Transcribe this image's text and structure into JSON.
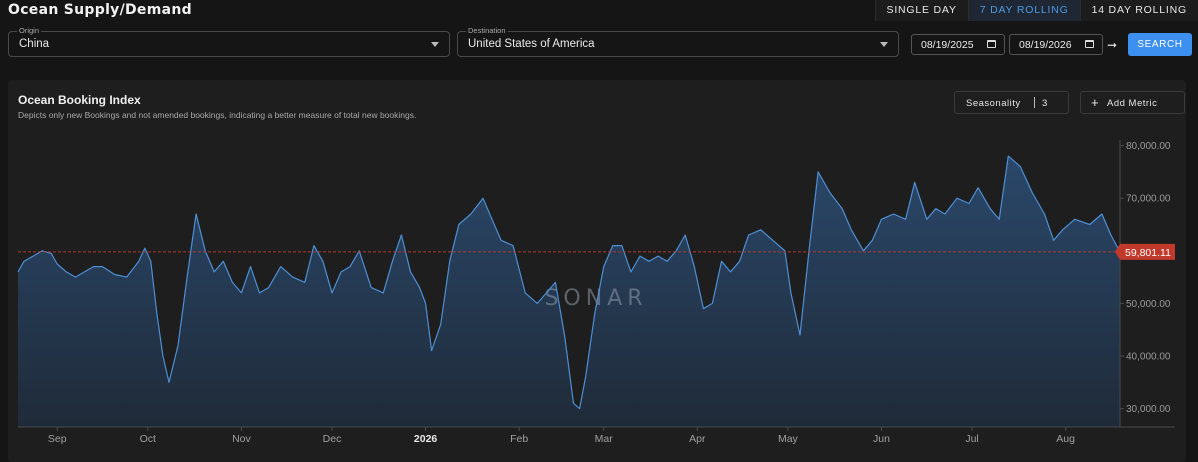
{
  "header": {
    "title": "Ocean Supply/Demand"
  },
  "timeframe": {
    "options": [
      "SINGLE DAY",
      "7 DAY ROLLING",
      "14 DAY ROLLING"
    ],
    "selected": "7 DAY ROLLING"
  },
  "filters": {
    "origin": {
      "label": "Origin",
      "value": "China"
    },
    "destination": {
      "label": "Destination",
      "value": "United States of America"
    },
    "start_date": "08/19/2025",
    "end_date": "08/19/2026",
    "arrow": "➞",
    "search_label": "SEARCH"
  },
  "panel": {
    "title": "Ocean Booking Index",
    "subtitle": "Depicts only new Bookings and not amended bookings, indicating a better measure of total new bookings.",
    "seasonality_label": "Seasonality",
    "seasonality_value": "3",
    "add_metric_label": "Add Metric",
    "add_metric_icon": "plus-icon",
    "watermark": "SONAR"
  },
  "colors": {
    "line": "#4d8fd6",
    "area_top": "#2b4a6e",
    "area_bottom": "#1f2b3a",
    "current_value_tag": "#c0392b",
    "accent": "#3d8ff0"
  },
  "chart_data": {
    "type": "area",
    "title": "Ocean Booking Index",
    "x_start": "2025-08-19",
    "x_end": "2026-08-19",
    "x_tick_labels": [
      "Sep",
      "Oct",
      "Nov",
      "Dec",
      "2026",
      "Feb",
      "Mar",
      "Apr",
      "May",
      "Jun",
      "Jul",
      "Aug"
    ],
    "x_tick_dates": [
      "2025-09-01",
      "2025-10-01",
      "2025-11-01",
      "2025-12-01",
      "2026-01-01",
      "2026-02-01",
      "2026-03-01",
      "2026-04-01",
      "2026-05-01",
      "2026-06-01",
      "2026-07-01",
      "2026-08-01"
    ],
    "y_tick_labels": [
      "30,000.00",
      "40,000.00",
      "50,000.00",
      "60,000.00",
      "70,000.00",
      "80,000.00"
    ],
    "y_ticks": [
      30000,
      40000,
      50000,
      60000,
      70000,
      80000
    ],
    "ylim": [
      26500,
      80500
    ],
    "current_value": 59801.11,
    "current_value_label": "59,801.11",
    "grid": false,
    "series": [
      {
        "points": [
          [
            "2025-08-19",
            56000
          ],
          [
            "2025-08-21",
            58000
          ],
          [
            "2025-08-24",
            59000
          ],
          [
            "2025-08-27",
            60000
          ],
          [
            "2025-08-30",
            59500
          ],
          [
            "2025-09-01",
            57500
          ],
          [
            "2025-09-04",
            56000
          ],
          [
            "2025-09-07",
            55000
          ],
          [
            "2025-09-10",
            56000
          ],
          [
            "2025-09-13",
            57000
          ],
          [
            "2025-09-16",
            57000
          ],
          [
            "2025-09-20",
            55500
          ],
          [
            "2025-09-24",
            55000
          ],
          [
            "2025-09-28",
            58000
          ],
          [
            "2025-09-30",
            60500
          ],
          [
            "2025-10-02",
            58000
          ],
          [
            "2025-10-04",
            48000
          ],
          [
            "2025-10-06",
            40000
          ],
          [
            "2025-10-08",
            35000
          ],
          [
            "2025-10-11",
            42000
          ],
          [
            "2025-10-14",
            55000
          ],
          [
            "2025-10-17",
            67000
          ],
          [
            "2025-10-20",
            60000
          ],
          [
            "2025-10-23",
            56000
          ],
          [
            "2025-10-26",
            58000
          ],
          [
            "2025-10-29",
            54000
          ],
          [
            "2025-11-01",
            52000
          ],
          [
            "2025-11-04",
            57000
          ],
          [
            "2025-11-07",
            52000
          ],
          [
            "2025-11-10",
            53000
          ],
          [
            "2025-11-14",
            57000
          ],
          [
            "2025-11-18",
            55000
          ],
          [
            "2025-11-22",
            54000
          ],
          [
            "2025-11-25",
            61000
          ],
          [
            "2025-11-28",
            58000
          ],
          [
            "2025-12-01",
            52000
          ],
          [
            "2025-12-04",
            56000
          ],
          [
            "2025-12-07",
            57000
          ],
          [
            "2025-12-10",
            60000
          ],
          [
            "2025-12-14",
            53000
          ],
          [
            "2025-12-18",
            52000
          ],
          [
            "2025-12-21",
            58000
          ],
          [
            "2025-12-24",
            63000
          ],
          [
            "2025-12-27",
            56000
          ],
          [
            "2025-12-30",
            53000
          ],
          [
            "2026-01-01",
            50000
          ],
          [
            "2026-01-03",
            41000
          ],
          [
            "2026-01-06",
            46000
          ],
          [
            "2026-01-09",
            58000
          ],
          [
            "2026-01-12",
            65000
          ],
          [
            "2026-01-16",
            67000
          ],
          [
            "2026-01-20",
            70000
          ],
          [
            "2026-01-23",
            66000
          ],
          [
            "2026-01-26",
            62000
          ],
          [
            "2026-01-30",
            61000
          ],
          [
            "2026-02-03",
            52000
          ],
          [
            "2026-02-07",
            50000
          ],
          [
            "2026-02-10",
            52000
          ],
          [
            "2026-02-13",
            54000
          ],
          [
            "2026-02-16",
            44000
          ],
          [
            "2026-02-19",
            31000
          ],
          [
            "2026-02-21",
            30000
          ],
          [
            "2026-02-23",
            36000
          ],
          [
            "2026-02-26",
            48000
          ],
          [
            "2026-03-01",
            57000
          ],
          [
            "2026-03-04",
            61000
          ],
          [
            "2026-03-07",
            61000
          ],
          [
            "2026-03-10",
            56000
          ],
          [
            "2026-03-13",
            59000
          ],
          [
            "2026-03-16",
            58000
          ],
          [
            "2026-03-19",
            59000
          ],
          [
            "2026-03-22",
            58000
          ],
          [
            "2026-03-25",
            60000
          ],
          [
            "2026-03-28",
            63000
          ],
          [
            "2026-03-31",
            57000
          ],
          [
            "2026-04-03",
            49000
          ],
          [
            "2026-04-06",
            50000
          ],
          [
            "2026-04-09",
            58000
          ],
          [
            "2026-04-12",
            56000
          ],
          [
            "2026-04-15",
            58000
          ],
          [
            "2026-04-18",
            63000
          ],
          [
            "2026-04-22",
            64000
          ],
          [
            "2026-04-26",
            62000
          ],
          [
            "2026-04-30",
            60000
          ],
          [
            "2026-05-02",
            52000
          ],
          [
            "2026-05-05",
            44000
          ],
          [
            "2026-05-08",
            60000
          ],
          [
            "2026-05-11",
            75000
          ],
          [
            "2026-05-15",
            71000
          ],
          [
            "2026-05-19",
            68000
          ],
          [
            "2026-05-22",
            64000
          ],
          [
            "2026-05-26",
            60000
          ],
          [
            "2026-05-29",
            62000
          ],
          [
            "2026-06-01",
            66000
          ],
          [
            "2026-06-05",
            67000
          ],
          [
            "2026-06-09",
            66000
          ],
          [
            "2026-06-12",
            73000
          ],
          [
            "2026-06-16",
            66000
          ],
          [
            "2026-06-19",
            68000
          ],
          [
            "2026-06-22",
            67000
          ],
          [
            "2026-06-26",
            70000
          ],
          [
            "2026-06-30",
            69000
          ],
          [
            "2026-07-03",
            72000
          ],
          [
            "2026-07-07",
            68000
          ],
          [
            "2026-07-10",
            66000
          ],
          [
            "2026-07-13",
            78000
          ],
          [
            "2026-07-17",
            76000
          ],
          [
            "2026-07-21",
            71000
          ],
          [
            "2026-07-25",
            67000
          ],
          [
            "2026-07-28",
            62000
          ],
          [
            "2026-07-31",
            64000
          ],
          [
            "2026-08-04",
            66000
          ],
          [
            "2026-08-09",
            65000
          ],
          [
            "2026-08-13",
            67000
          ],
          [
            "2026-08-16",
            63000
          ],
          [
            "2026-08-19",
            59800
          ]
        ]
      }
    ]
  }
}
